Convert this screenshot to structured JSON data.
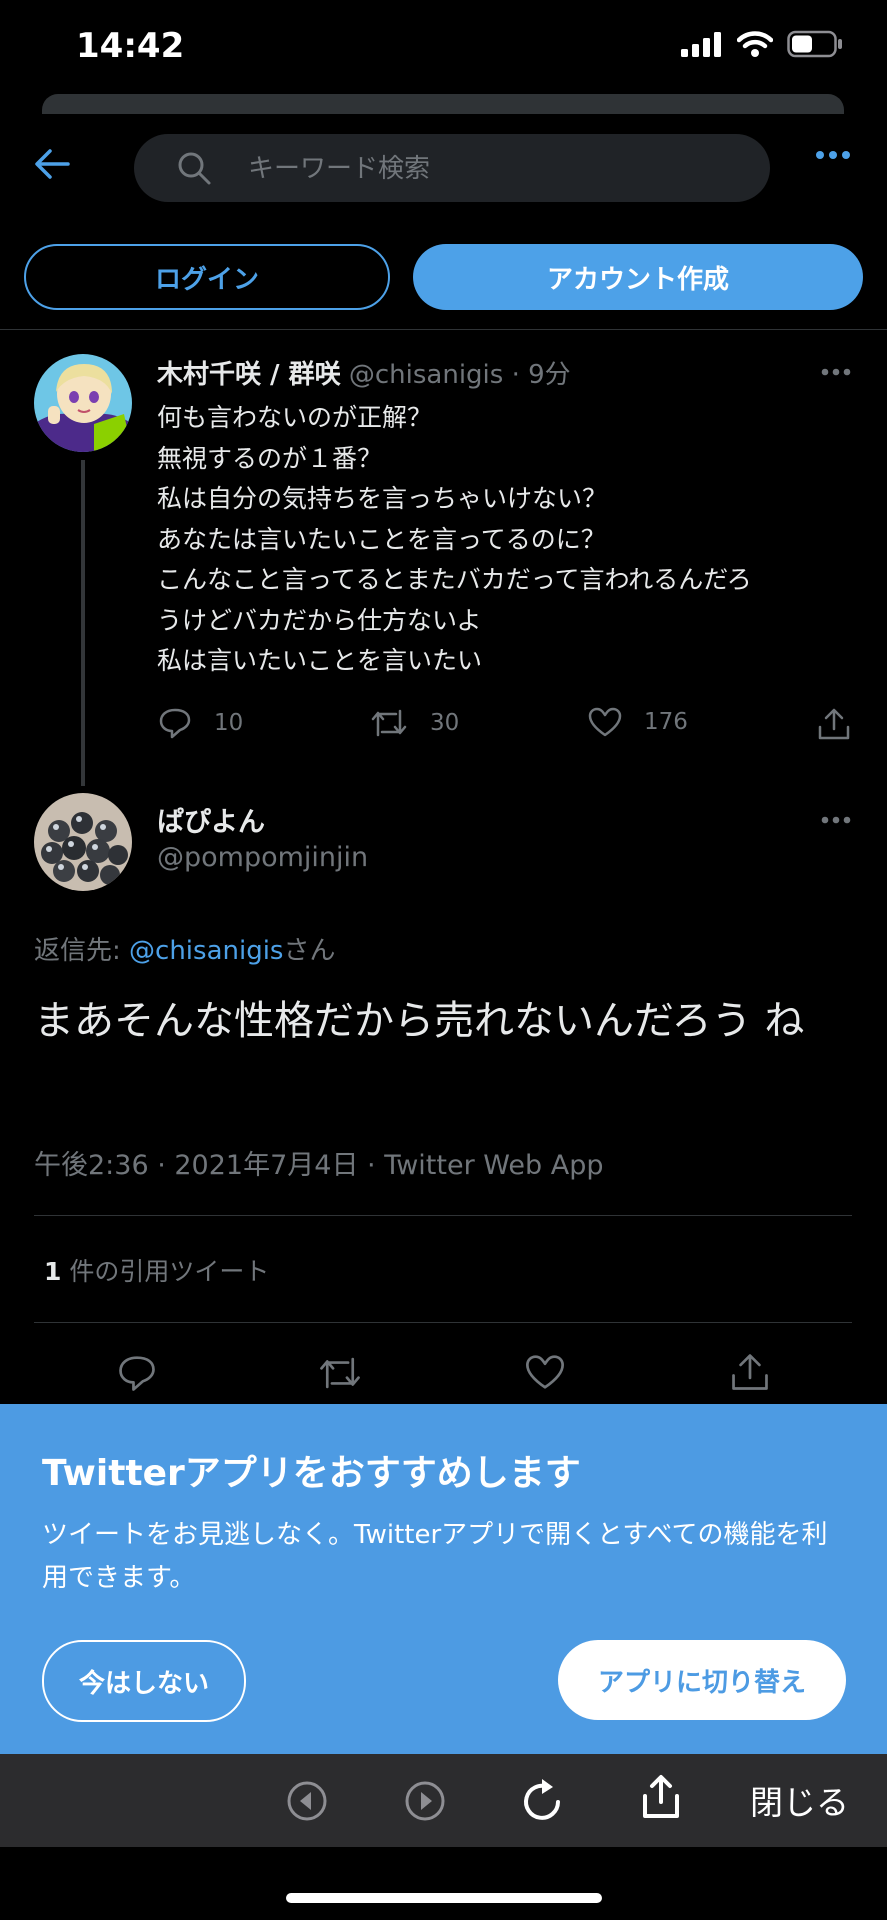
{
  "status_bar": {
    "time": "14:42",
    "icons": [
      "cellular-signal-icon",
      "wifi-icon",
      "battery-icon"
    ]
  },
  "search": {
    "placeholder": "キーワード検索"
  },
  "auth": {
    "login_label": "ログイン",
    "signup_label": "アカウント作成"
  },
  "tweet1": {
    "display_name": "木村千咲 / 群咲",
    "handle": "@chisanigis",
    "time_ago": "· 9分",
    "lines": [
      "何も言わないのが正解？",
      "無視するのが１番？",
      "私は自分の気持ちを言っちゃいけない？",
      "あなたは言いたいことを言ってるのに？",
      "こんなこと言ってるとまたバカだって言われるんだろ",
      "うけどバカだから仕方ないよ",
      "私は言いたいことを言いたい"
    ],
    "replies": "10",
    "retweets": "30",
    "likes": "176"
  },
  "tweet2": {
    "display_name": "ぱぴよん",
    "handle": "@pompomjinjin",
    "reply_prefix": "返信先: ",
    "reply_mention": "@chisanigis",
    "reply_suffix": "さん",
    "text": "まあそんな性格だから売れないんだろう ね",
    "meta": "午後2:36 · 2021年7月4日 · Twitter Web App",
    "quote_count": "1",
    "quote_label": " 件の引用ツイート"
  },
  "banner": {
    "title": "Twitterアプリをおすすめします",
    "text": "ツイートをお見逃しなく。Twitterアプリで開くとすべての機能を利用できます。",
    "not_now_label": "今はしない",
    "switch_label": "アプリに切り替え"
  },
  "toolbar": {
    "close_label": "閉じる"
  },
  "colors": {
    "accent": "#4da1e8",
    "banner": "#4d9be3",
    "background": "#000000",
    "muted": "#71767b"
  }
}
